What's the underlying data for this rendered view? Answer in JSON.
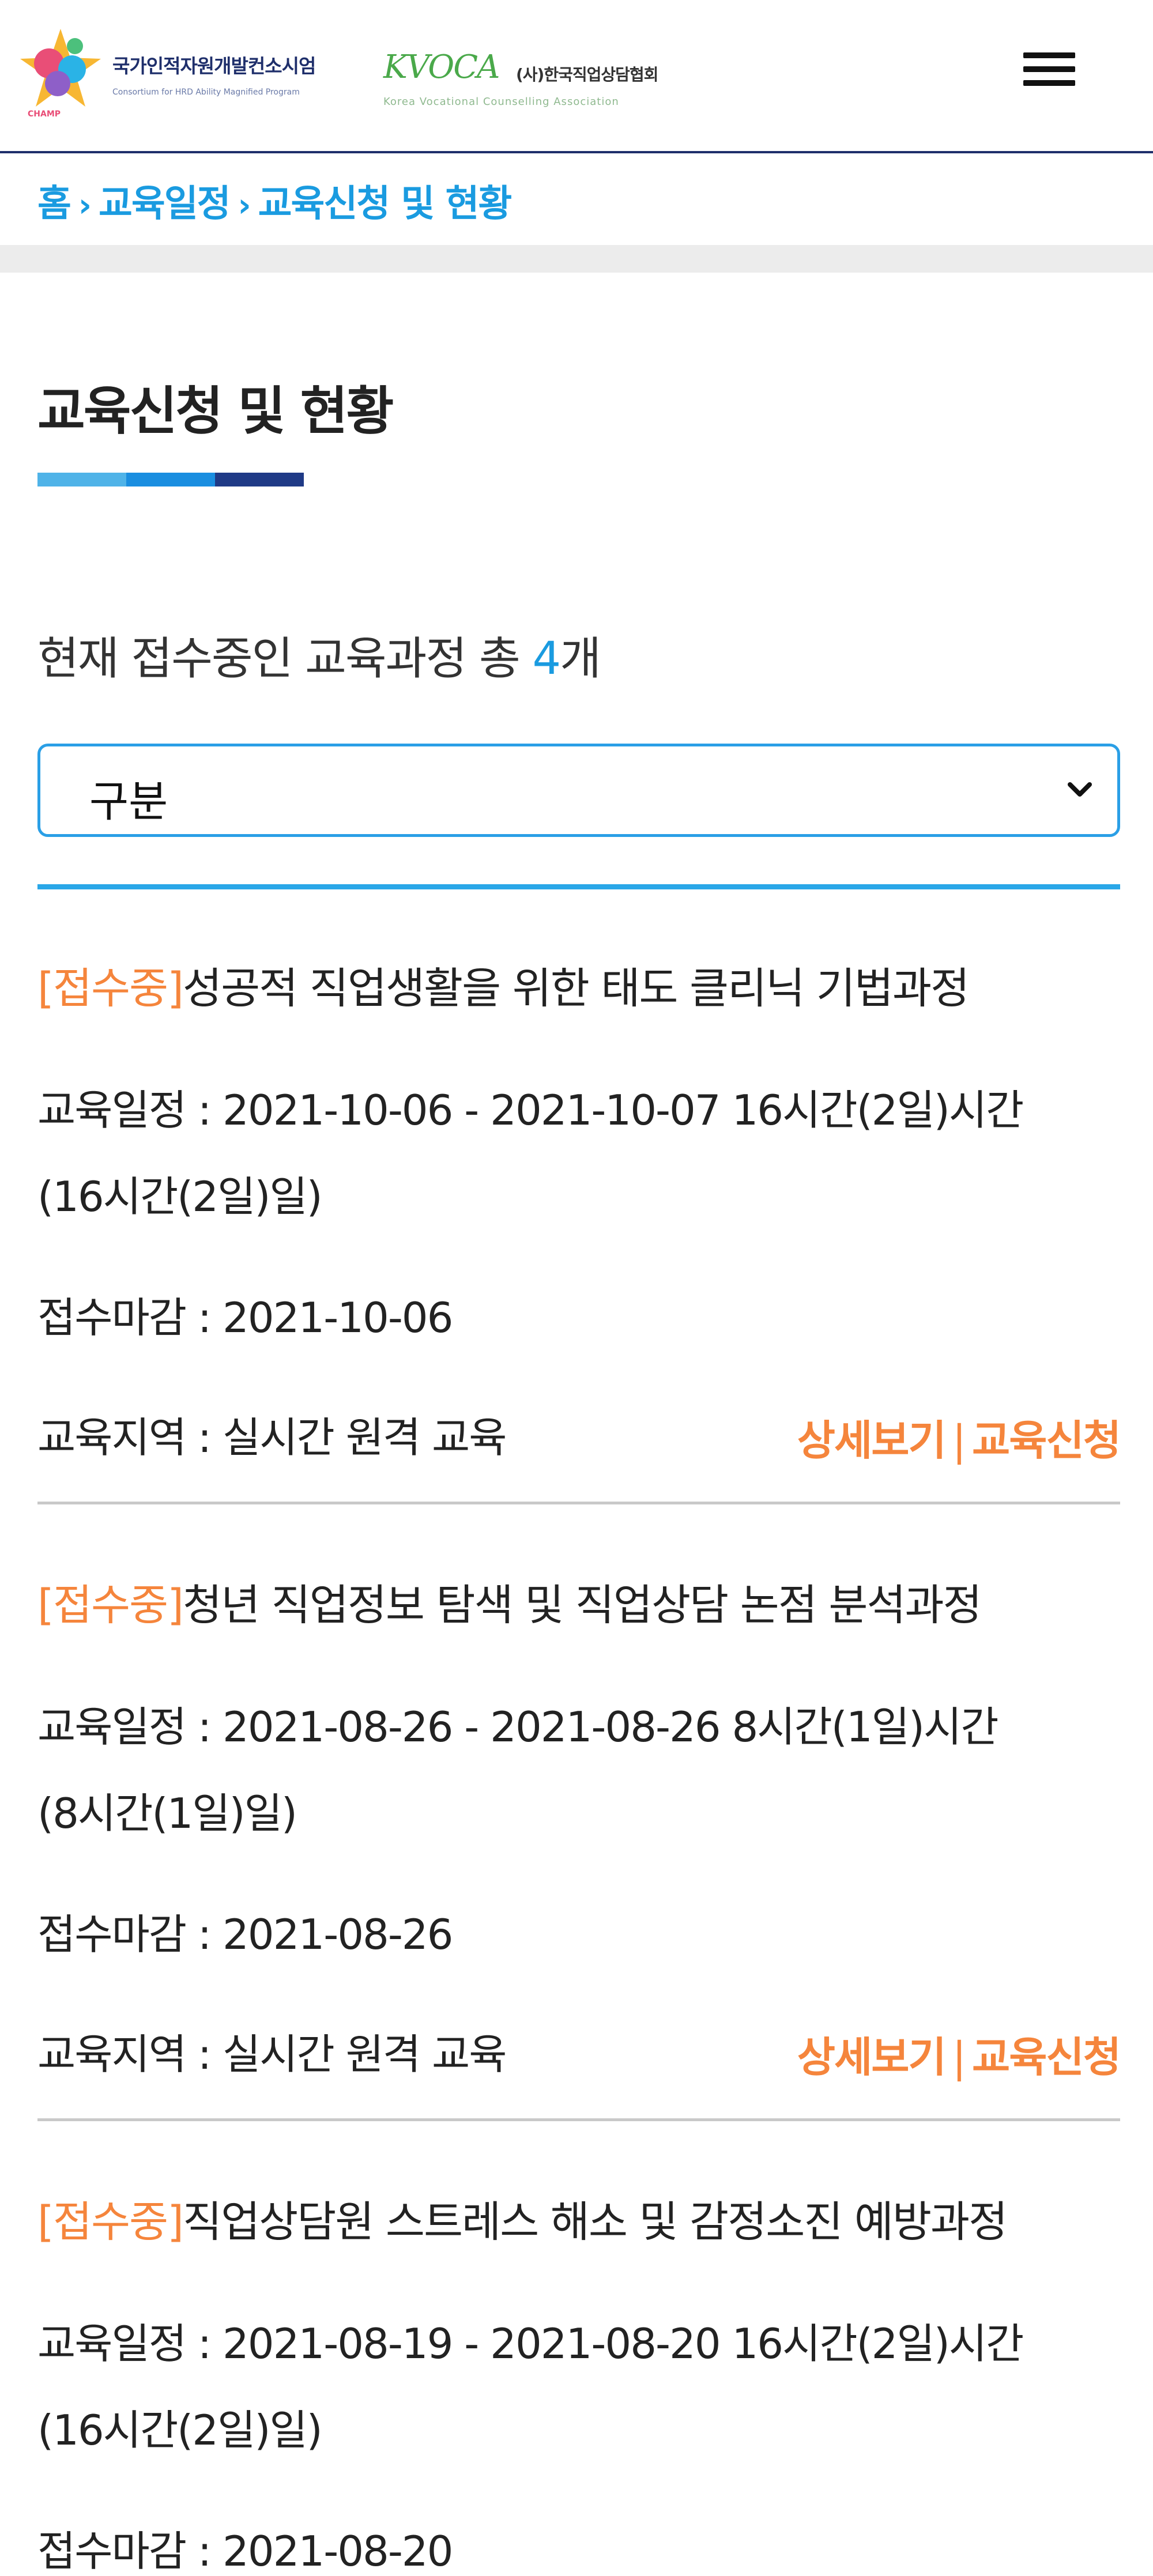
{
  "header": {
    "hrd_logo_title": "국가인적자원개발컨소시엄",
    "hrd_logo_sub": "Consortium for HRD Ability Magnified Program",
    "hrd_logo_badge": "CHAMP",
    "kvoca_brand": "KVOCA",
    "kvoca_org": "(사)한국직업상담협회",
    "kvoca_eng": "Korea Vocational Counselling Association",
    "menu_icon": "hamburger-menu-icon"
  },
  "breadcrumb": {
    "items": [
      "홈",
      "교육일정",
      "교육신청 및 현황"
    ],
    "separator": "›"
  },
  "page": {
    "title": "교육신청 및 현황",
    "count_prefix": "현재 접수중인 교육과정 총 ",
    "count_value": "4",
    "count_suffix": "개"
  },
  "filter": {
    "selected": "구분"
  },
  "colors": {
    "accent_blue": "#1a9be0",
    "status_orange": "#f5853c",
    "navy": "#1f3a86"
  },
  "courses": [
    {
      "status": "[접수중]",
      "title": "성공적 직업생활을 위한 태도 클리닉 기법과정",
      "schedule_line1": "교육일정 : 2021-10-06 - 2021-10-07 16시간(2일)시간",
      "schedule_line2": "(16시간(2일)일)",
      "deadline": "접수마감 : 2021-10-06",
      "region": "교육지역 : 실시간 원격 교육",
      "detail_label": "상세보기",
      "apply_label": "교육신청"
    },
    {
      "status": "[접수중]",
      "title": "청년 직업정보 탐색 및 직업상담 논점 분석과정",
      "schedule_line1": "교육일정 : 2021-08-26 - 2021-08-26 8시간(1일)시간",
      "schedule_line2": "(8시간(1일)일)",
      "deadline": "접수마감 : 2021-08-26",
      "region": "교육지역 : 실시간 원격 교육",
      "detail_label": "상세보기",
      "apply_label": "교육신청"
    },
    {
      "status": "[접수중]",
      "title": "직업상담원 스트레스 해소 및 감정소진 예방과정",
      "schedule_line1": "교육일정 : 2021-08-19 - 2021-08-20 16시간(2일)시간",
      "schedule_line2": "(16시간(2일)일)",
      "deadline": "접수마감 : 2021-08-20"
    }
  ]
}
